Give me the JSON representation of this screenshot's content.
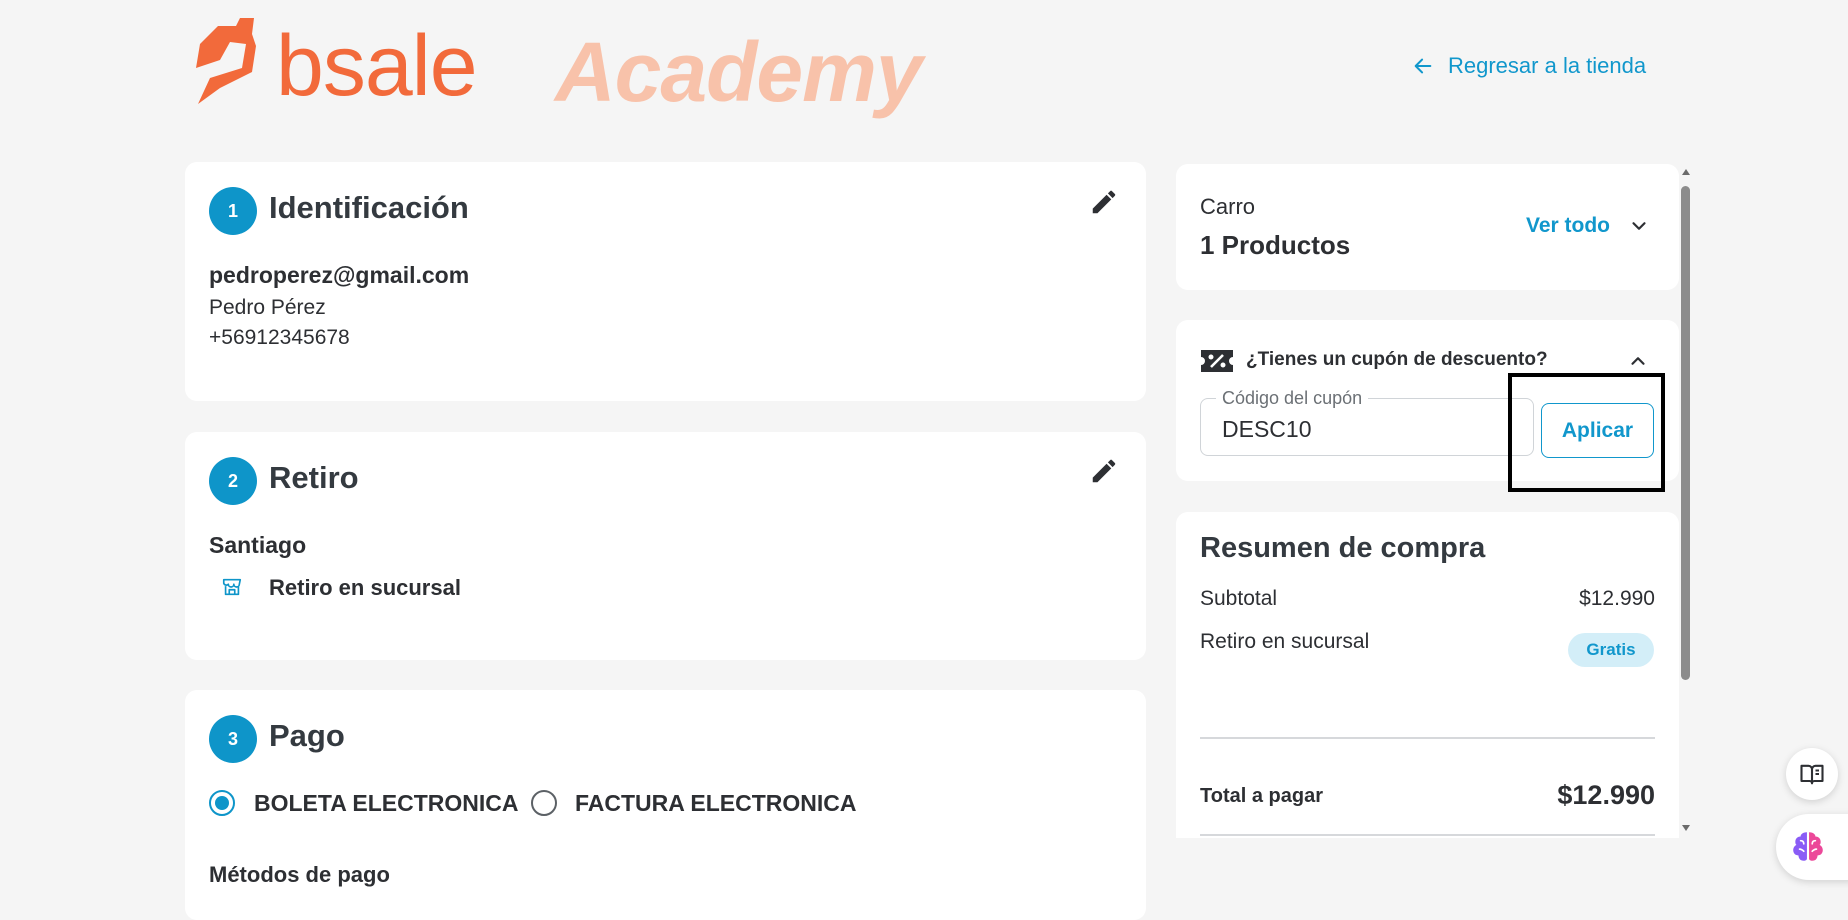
{
  "header": {
    "logo_brand": "bsale",
    "logo_sub": "Academy",
    "back_link": "Regresar a la tienda"
  },
  "colors": {
    "accent": "#0e95c9",
    "brand_orange": "#f26a3b",
    "brand_orange_light": "#f8c2aa"
  },
  "steps": {
    "identification": {
      "number": "1",
      "title": "Identificación",
      "email": "pedroperez@gmail.com",
      "name": "Pedro Pérez",
      "phone": "+56912345678"
    },
    "pickup": {
      "number": "2",
      "title": "Retiro",
      "city": "Santiago",
      "method": "Retiro en sucursal"
    },
    "payment": {
      "number": "3",
      "title": "Pago",
      "doc_options": [
        "BOLETA ELECTRONICA",
        "FACTURA ELECTRONICA"
      ],
      "selected_doc": "BOLETA ELECTRONICA",
      "methods_label": "Métodos de pago"
    }
  },
  "cart": {
    "label": "Carro",
    "count_text": "1 Productos",
    "view_all": "Ver todo"
  },
  "coupon": {
    "question": "¿Tienes un cupón de descuento?",
    "field_label": "Código del cupón",
    "value": "DESC10",
    "apply_label": "Aplicar"
  },
  "summary": {
    "title": "Resumen de compra",
    "subtotal_label": "Subtotal",
    "subtotal_value": "$12.990",
    "pickup_label": "Retiro en sucursal",
    "pickup_value": "Gratis",
    "total_label": "Total a pagar",
    "total_value": "$12.990"
  },
  "icons": {
    "back": "arrow-left-icon",
    "edit": "pencil-icon",
    "store": "store-icon",
    "chevron": "chevron-down-icon",
    "coupon": "ticket-percent-icon",
    "collapse": "chevron-up-icon",
    "book": "book-open-icon",
    "brain": "brain-icon"
  }
}
